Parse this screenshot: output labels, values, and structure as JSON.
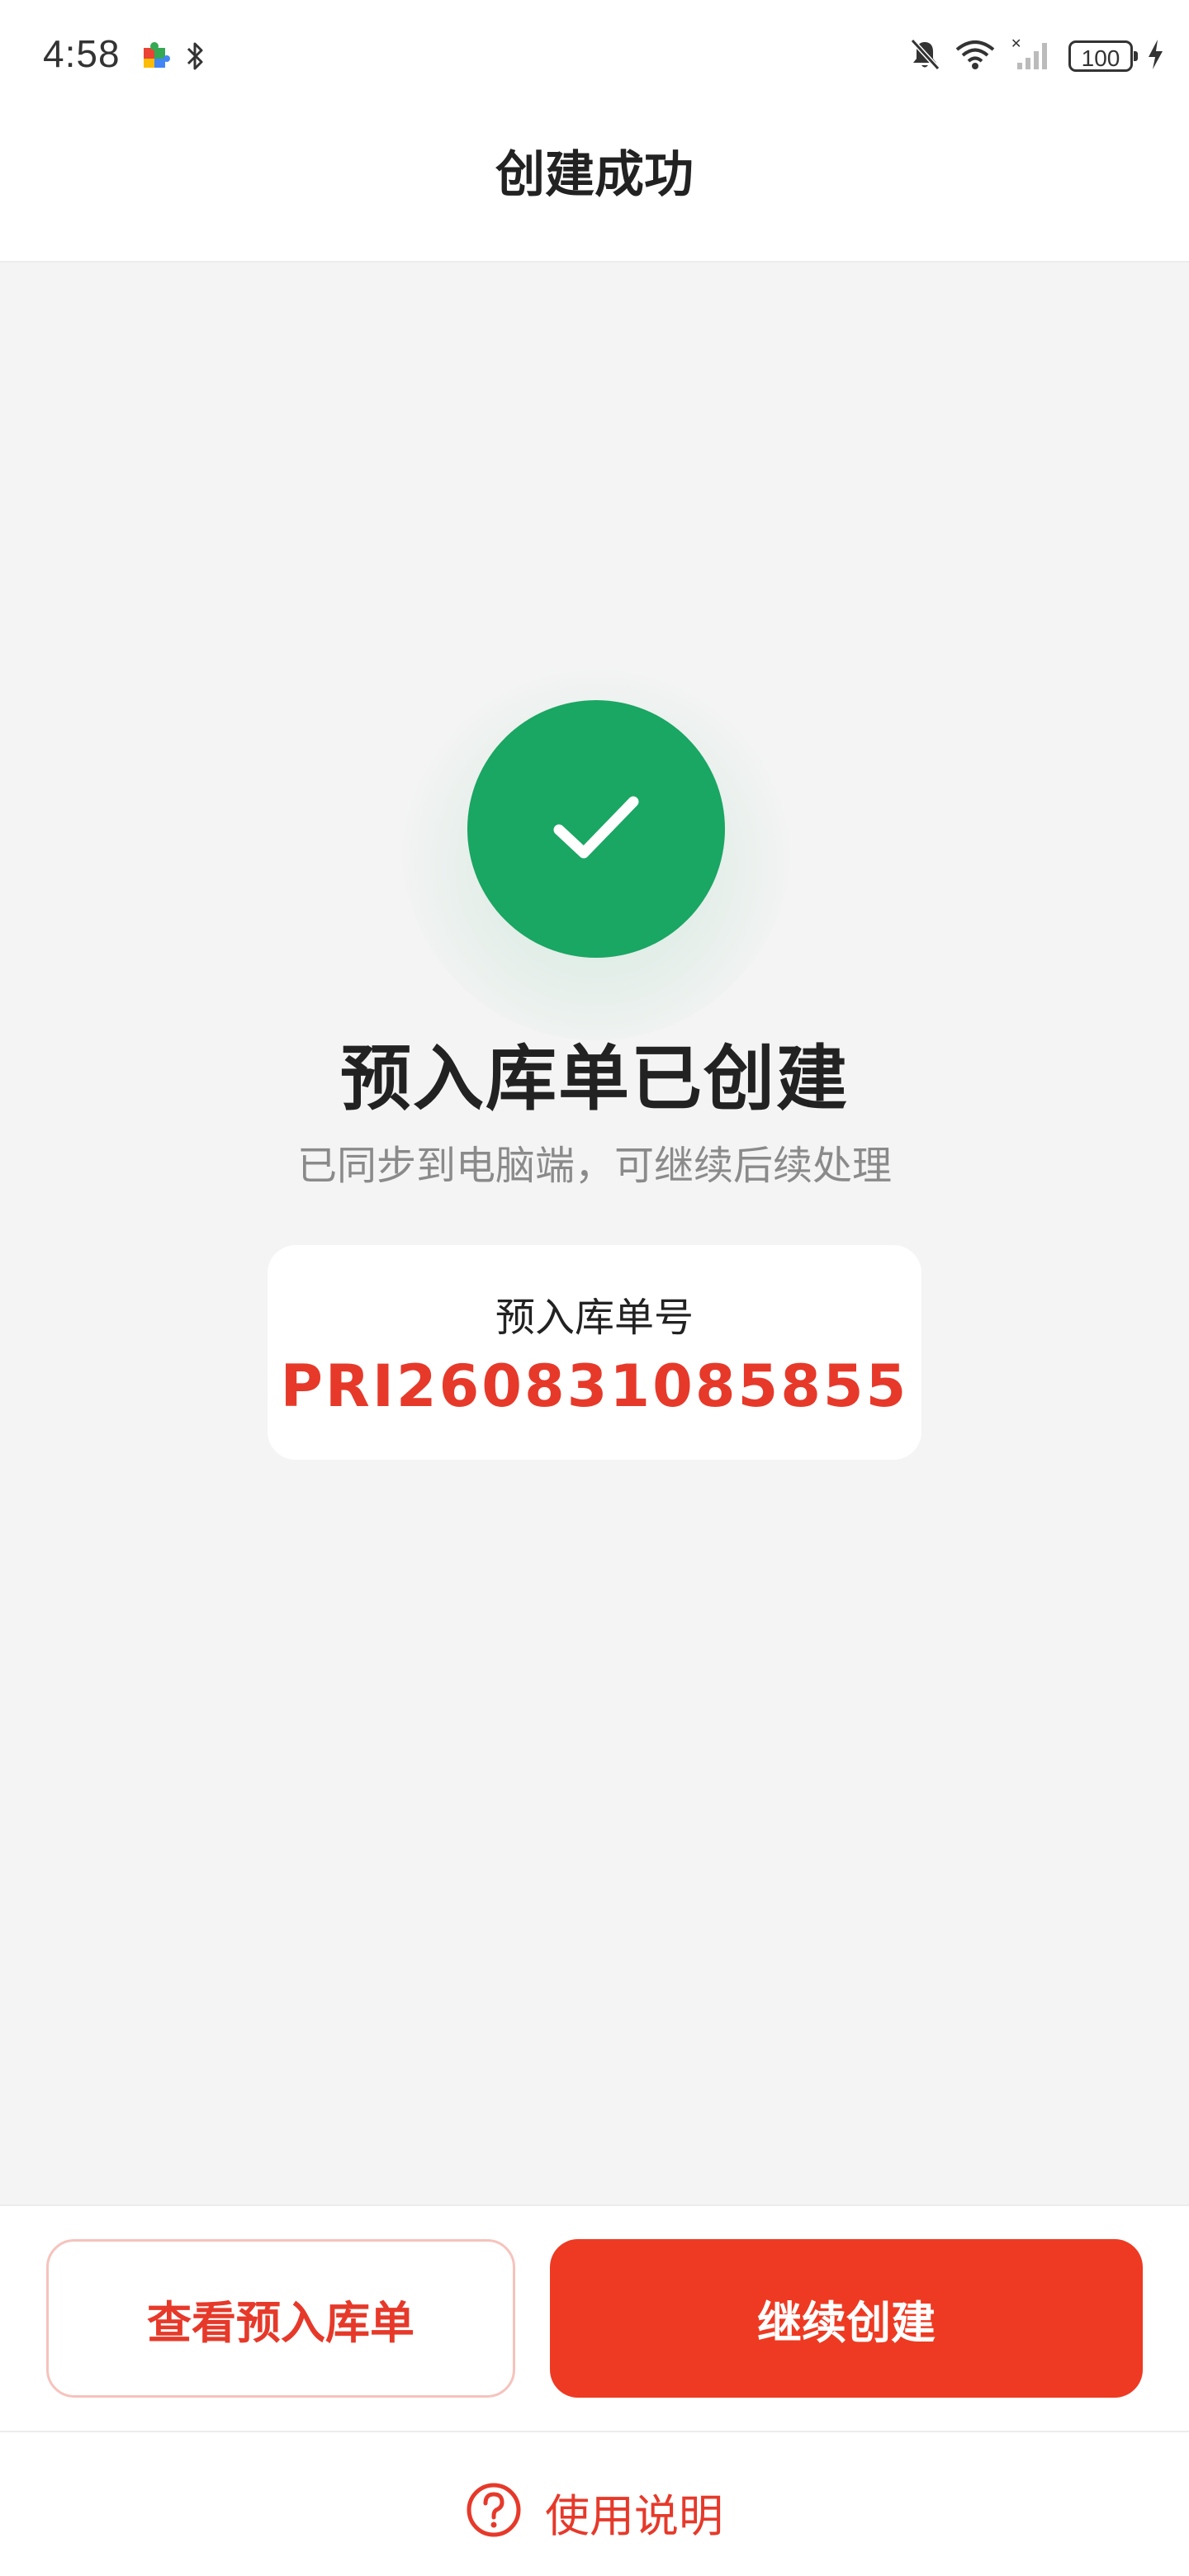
{
  "status_bar": {
    "time": "4:58",
    "battery": "100",
    "left_icons": [
      "puzzle-app-icon",
      "bluetooth-icon"
    ],
    "right_icons": [
      "bell-muted-icon",
      "wifi-icon",
      "cellular-no-signal-icon",
      "battery-icon",
      "charging-icon"
    ]
  },
  "header": {
    "title": "创建成功"
  },
  "result": {
    "icon": "check-icon",
    "title": "预入库单已创建",
    "subtitle": "已同步到电脑端，可继续后续处理"
  },
  "order_card": {
    "label": "预入库单号",
    "number": "PRI260831085855"
  },
  "actions": {
    "view_label": "查看预入库单",
    "continue_label": "继续创建"
  },
  "help": {
    "icon": "question-circle-icon",
    "label": "使用说明"
  },
  "colors": {
    "accent": "#ee3a22",
    "accent_text": "#e6392a",
    "success": "#1aa663",
    "background": "#f4f4f4"
  }
}
